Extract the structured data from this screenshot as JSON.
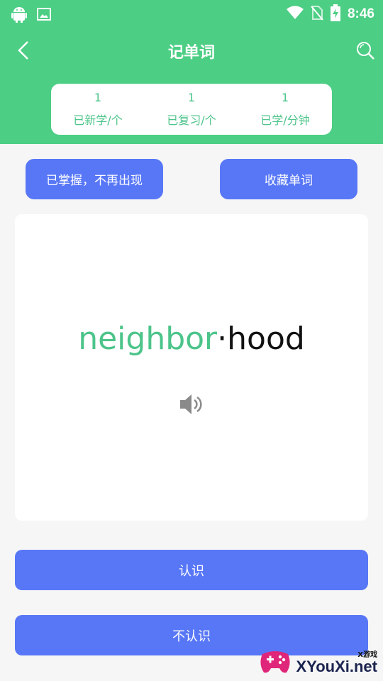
{
  "status_bar": {
    "time": "8:46",
    "left_icons": [
      "android-icon",
      "image-icon"
    ],
    "right_icons": [
      "wifi-icon",
      "no-sim-icon",
      "battery-charging-icon"
    ]
  },
  "header": {
    "title": "记单词",
    "background_color": "#4cce84"
  },
  "stats": [
    {
      "value": "1",
      "label": "已新学/个"
    },
    {
      "value": "1",
      "label": "已复习/个"
    },
    {
      "value": "1",
      "label": "已学/分钟"
    }
  ],
  "actions": {
    "mastered_label": "已掌握，不再出现",
    "collect_label": "收藏单词"
  },
  "word": {
    "syllable_learned": "neighbor",
    "separator": "·",
    "syllable_rest": "hood"
  },
  "bottom": {
    "know_label": "认识",
    "unknown_label": "不认识"
  },
  "watermark": {
    "sub": "X游戏",
    "main": "XYouXi.net"
  },
  "colors": {
    "accent_green": "#4cc48a",
    "button_blue": "#5877f7"
  }
}
